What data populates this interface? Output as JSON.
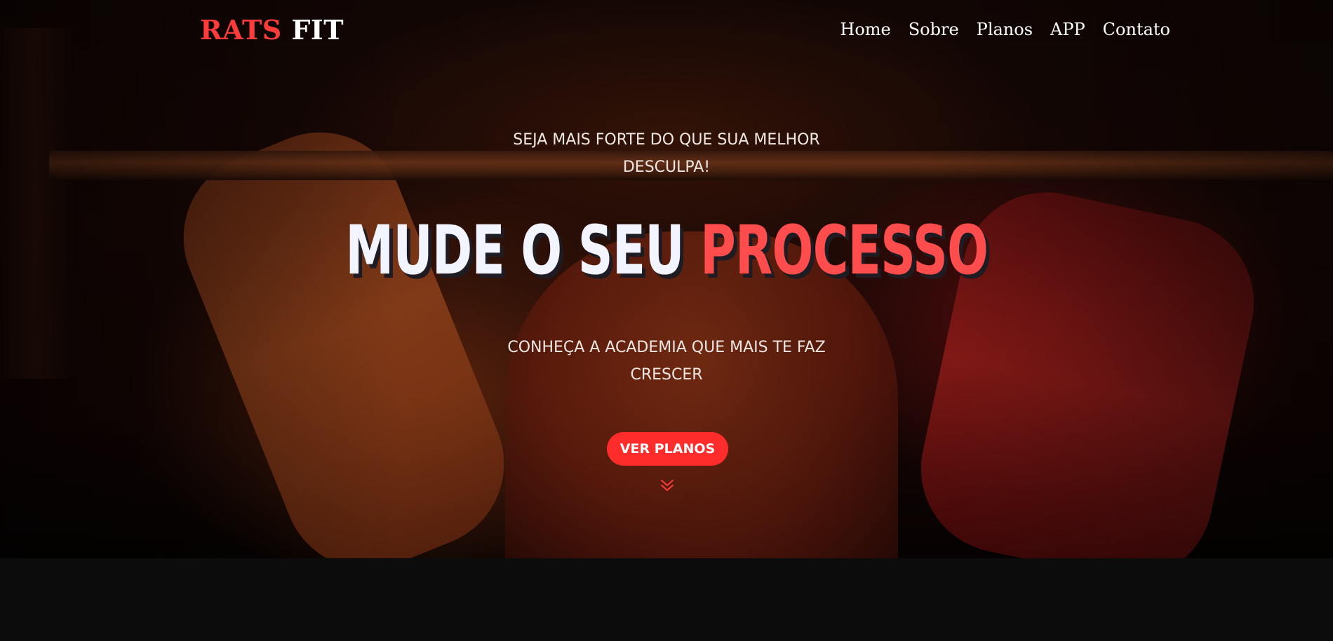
{
  "brand": {
    "part1": "RATS",
    "part2": "FIT",
    "accent_color": "#ff3b3b"
  },
  "nav": {
    "items": [
      {
        "label": "Home"
      },
      {
        "label": "Sobre"
      },
      {
        "label": "Planos"
      },
      {
        "label": "APP"
      },
      {
        "label": "Contato"
      }
    ]
  },
  "hero": {
    "tagline": "SEJA MAIS FORTE DO QUE SUA MELHOR DESCULPA!",
    "headline_white": "MUDE O SEU",
    "headline_red": "PROCESSO",
    "subline": "CONHEÇA A ACADEMIA QUE MAIS TE FAZ CRESCER",
    "cta_label": "VER PLANOS",
    "scroll_icon": "chevron-double-down-icon",
    "background_image": "athlete lifting barbell with tattooed arms, red/orange tint"
  },
  "colors": {
    "primary_red": "#ff2c2c",
    "headline_red": "#ff4d4d",
    "text_light": "#f0e6e2",
    "section_bg": "#0c0c0c"
  }
}
